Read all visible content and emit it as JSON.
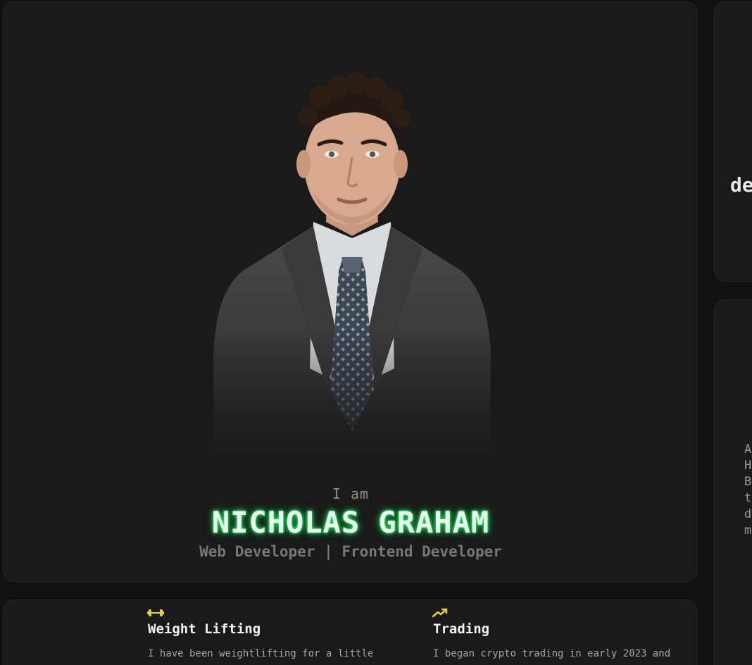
{
  "hero": {
    "intro": "I am",
    "name": "NICHOLAS GRAHAM",
    "role": "Web Developer | Frontend Developer"
  },
  "hobbies": [
    {
      "icon": "dumbbell-icon",
      "title": "Weight Lifting",
      "description": "I have been weightlifting for a little"
    },
    {
      "icon": "trending-up-icon",
      "title": "Trading",
      "description": "I began crypto trading in early 2023 and"
    }
  ],
  "right_panel": {
    "top_text": "de",
    "bottom_lines": [
      "A",
      "H",
      "B",
      "t",
      "d",
      "m"
    ]
  },
  "colors": {
    "background": "#111111",
    "card": "#1a1a1a",
    "name_glow": "#22ff66",
    "icon_accent": "#e8d22a"
  }
}
